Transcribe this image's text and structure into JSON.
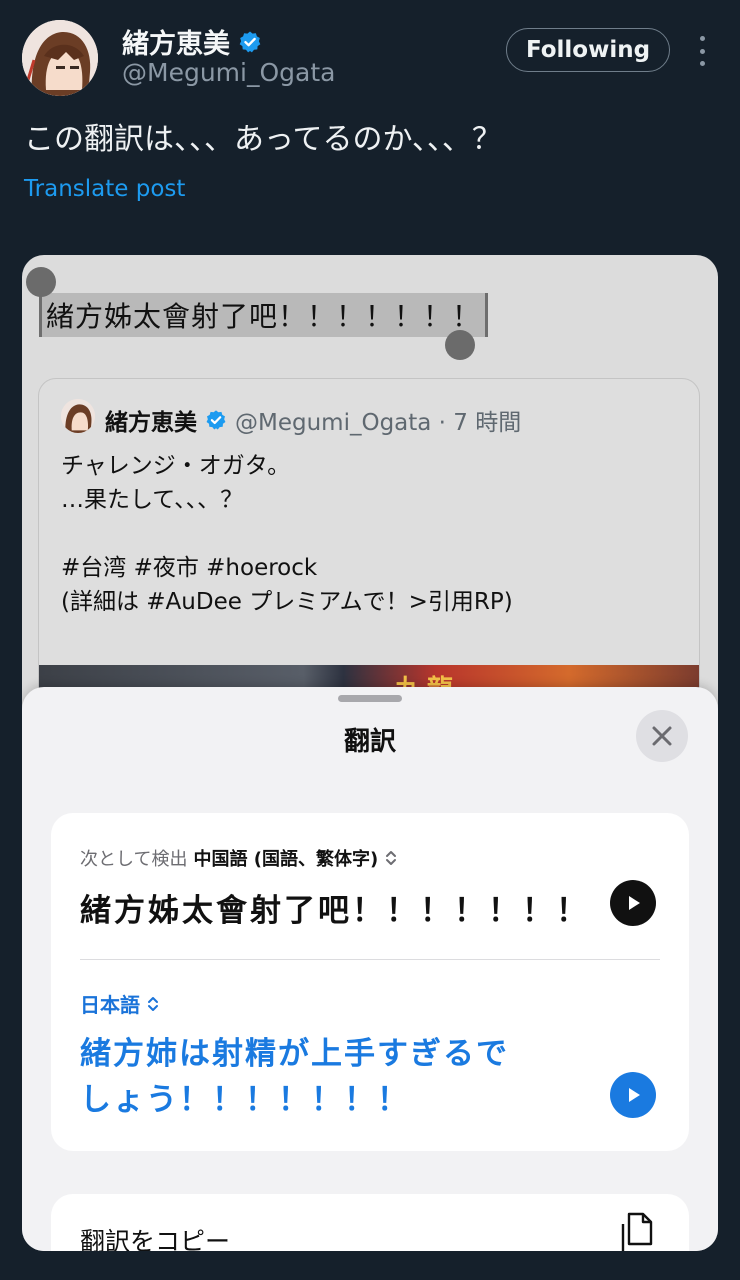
{
  "tweet": {
    "display_name": "緒方恵美",
    "handle": "@Megumi_Ogata",
    "follow_button": "Following",
    "text": "この翻訳は、、、あってるのか、、、？",
    "translate_link": "Translate post"
  },
  "screenshot": {
    "selected_text": "緒方姊太會射了吧！！！！！！！",
    "quoted_post": {
      "display_name": "緒方恵美",
      "handle_time": "@Megumi_Ogata · 7 時間",
      "lines": [
        "チャレンジ・オガタ。",
        "…果たして、、、？",
        "",
        "#台湾 #夜市 #hoerock",
        "(詳細は #AuDee プレミアムで！>引用RP)"
      ],
      "image_text": "九龍"
    },
    "translate_sheet": {
      "title": "翻訳",
      "detected_prefix": "次として検出",
      "detected_language": "中国語 (国語、繁体字)",
      "source_text": "緒方姊太會射了吧！！！！！！！",
      "target_language": "日本語",
      "target_text": "緒方姉は射精が上手すぎるでしょう！！！！！！！",
      "copy_label": "翻訳をコピー"
    }
  },
  "colors": {
    "background": "#15202b",
    "accent": "#1d9bf0",
    "verified": "#1d9bf0",
    "translation_blue": "#1a7ae0"
  },
  "icons": [
    "verified-badge-icon",
    "more-options-icon",
    "close-icon",
    "play-icon",
    "copy-icon",
    "updown-chevron-icon"
  ]
}
